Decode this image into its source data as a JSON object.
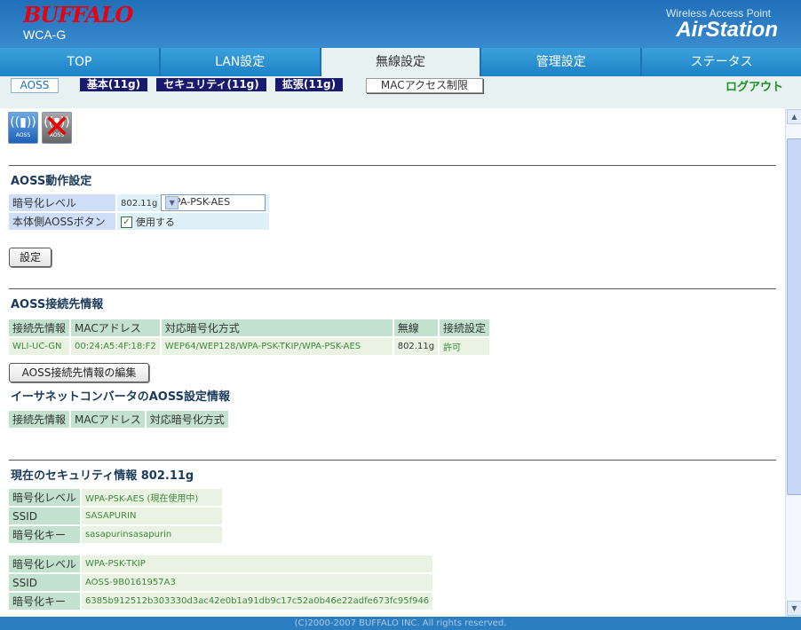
{
  "header": {
    "brand": "BUFFALO",
    "model": "WCA-G",
    "product_sub": "Wireless Access Point",
    "product_name": "AirStation"
  },
  "tabs": [
    {
      "label": "TOP"
    },
    {
      "label": "LAN設定"
    },
    {
      "label": "無線設定",
      "active": true
    },
    {
      "label": "管理設定"
    },
    {
      "label": "ステータス"
    }
  ],
  "subnav": {
    "items": [
      "AOSS",
      "基本(11g)",
      "セキュリティ(11g)",
      "拡張(11g)",
      "MACアクセス制限"
    ],
    "logout": "ログアウト"
  },
  "icons": {
    "aoss_on_label": "AOSS",
    "aoss_off_label": "AOSS"
  },
  "aoss_settings": {
    "title": "AOSS動作設定",
    "encryption_label": "暗号化レベル",
    "band": "802.11g",
    "encryption_value": "WPA-PSK-AES",
    "button_label": "本体側AOSSボタン",
    "button_check_label": "使用する",
    "button_checked": true,
    "submit_label": "設定"
  },
  "aoss_clients": {
    "title": "AOSS接続先情報",
    "headers": [
      "接続先情報",
      "MACアドレス",
      "対応暗号化方式",
      "無線",
      "接続設定"
    ],
    "rows": [
      [
        "WLI-UC-GN",
        "00:24:A5:4F:18:F2",
        "WEP64/WEP128/WPA-PSK-TKIP/WPA-PSK-AES",
        "802.11g",
        "許可"
      ]
    ],
    "edit_button": "AOSS接続先情報の編集"
  },
  "ethernet_converter": {
    "title": "イーサネットコンバータのAOSS設定情報",
    "headers": [
      "接続先情報",
      "MACアドレス",
      "対応暗号化方式"
    ]
  },
  "security_info": {
    "title": "現在のセキュリティ情報 802.11g",
    "block1": {
      "enc_label": "暗号化レベル",
      "enc_value": "WPA-PSK-AES (現在使用中)",
      "ssid_label": "SSID",
      "ssid_value": "SASAPURIN",
      "key_label": "暗号化キー",
      "key_value": "sasapurinsasapurin"
    },
    "block2": {
      "enc_label": "暗号化レベル",
      "enc_value": "WPA-PSK-TKIP",
      "ssid_label": "SSID",
      "ssid_value": "AOSS-9B0161957A3",
      "key_label": "暗号化キー",
      "key_value": "6385b912512b303330d3ac42e0b1a91db9c17c52a0b46e22adfe673fc95f946"
    }
  },
  "footer": {
    "copyright": "(C)2000-2007 BUFFALO INC. All rights reserved."
  }
}
